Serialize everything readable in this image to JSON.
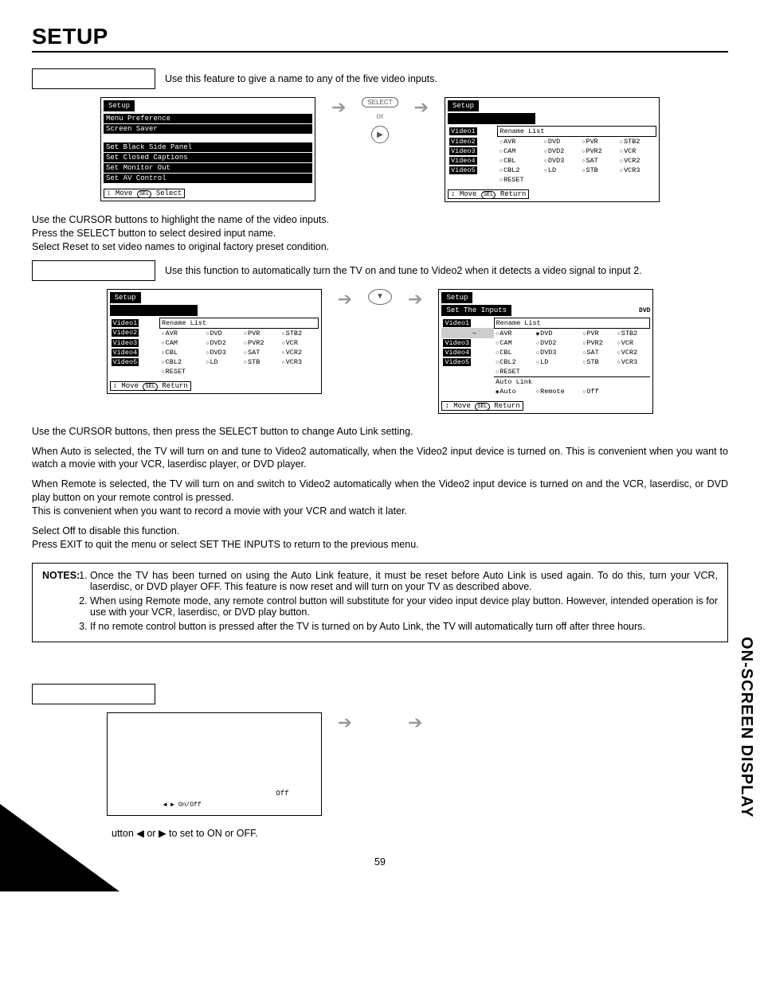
{
  "page": {
    "title": "SETUP",
    "sidebar": "ON-SCREEN DISPLAY",
    "number": "59"
  },
  "feat1": {
    "desc": "Use this feature to give a name to any of the five video inputs."
  },
  "osdA": {
    "tab": "Setup",
    "items": [
      "Menu Preference",
      "Screen Saver",
      "",
      "Set Black Side Panel",
      "Set Closed Captions",
      "Set Monitor Out",
      "Set AV Control"
    ],
    "foot_move": "Move",
    "foot_sel": "SEL",
    "foot_action": "Select"
  },
  "middle1": {
    "btn": "SELECT",
    "or": "or"
  },
  "osdB": {
    "tab": "Setup",
    "header": "Rename List",
    "videos": [
      "Video1",
      "Video2",
      "Video3",
      "Video4",
      "Video5"
    ],
    "opts": [
      [
        "AVR",
        "DVD",
        "PVR",
        "STB2"
      ],
      [
        "CAM",
        "DVD2",
        "PVR2",
        "VCR"
      ],
      [
        "CBL",
        "DVD3",
        "SAT",
        "VCR2"
      ],
      [
        "CBL2",
        "LD",
        "STB",
        "VCR3"
      ],
      [
        "RESET",
        "",
        "",
        ""
      ]
    ],
    "foot_move": "Move",
    "foot_sel": "SEL",
    "foot_action": "Return"
  },
  "para1a": "Use the CURSOR buttons to highlight the name of the video inputs.",
  "para1b": "Press the SELECT button to select desired input name.",
  "para1c": "Select Reset to set video names to original factory preset condition.",
  "feat2": {
    "desc": "Use this function to automatically turn the TV on and tune to Video2 when it detects a video signal to input 2."
  },
  "osdC": {
    "tab": "Setup",
    "header": "Rename List",
    "videos": [
      "Video1",
      "Video2",
      "Video3",
      "Video4",
      "Video5"
    ],
    "opts": [
      [
        "AVR",
        "DVD",
        "PVR",
        "STB2"
      ],
      [
        "CAM",
        "DVD2",
        "PVR2",
        "VCR"
      ],
      [
        "CBL",
        "DVD3",
        "SAT",
        "VCR2"
      ],
      [
        "CBL2",
        "LD",
        "STB",
        "VCR3"
      ],
      [
        "RESET",
        "",
        "",
        ""
      ]
    ],
    "foot_move": "Move",
    "foot_sel": "SEL",
    "foot_action": "Return"
  },
  "osdD": {
    "tab": "Setup",
    "subtitle": "Set The Inputs",
    "badge": "DVD",
    "header": "Rename List",
    "videos": [
      "Video1",
      "",
      "Video3",
      "Video4",
      "Video5"
    ],
    "opts": [
      [
        "AVR",
        "DVD",
        "PVR",
        "STB2"
      ],
      [
        "CAM",
        "DVD2",
        "PVR2",
        "VCR"
      ],
      [
        "CBL",
        "DVD3",
        "SAT",
        "VCR2"
      ],
      [
        "CBL2",
        "LD",
        "STB",
        "VCR3"
      ],
      [
        "RESET",
        "",
        "",
        ""
      ]
    ],
    "autolink_label": "Auto Link",
    "autolink_opts": [
      "Auto",
      "Remote",
      "Off"
    ],
    "foot_move": "Move",
    "foot_sel": "SEL",
    "foot_action": "Return"
  },
  "para2": "Use the CURSOR buttons, then press the SELECT button to change Auto Link setting.",
  "para3": "When Auto is selected, the TV will turn on and tune to Video2 automatically, when the Video2 input device is turned on. This is convenient when you want to watch a movie with your VCR, laserdisc player, or DVD player.",
  "para4a": "When Remote is selected, the TV will turn on and switch to Video2 automatically when the Video2 input device is turned on and the VCR, laserdisc, or DVD play button on your remote control is pressed.",
  "para4b": "This is convenient when you want to record a movie with your VCR and watch it later.",
  "para5a": "Select Off to disable this function.",
  "para5b": "Press EXIT to quit the menu or select SET THE INPUTS to return to the previous menu.",
  "notes": {
    "label": "NOTES:",
    "items": [
      "Once the TV has been turned on using the Auto Link feature, it must be reset before Auto Link is used again. To do this, turn your VCR, laserdisc, or DVD player OFF. This feature is now reset and will turn on your TV as described above.",
      "When using Remote mode, any remote control button will substitute for your video input device play button. However, intended operation is for use with your VCR, laserdisc, or DVD play button.",
      "If no remote control button is pressed after the TV is turned on by Auto Link, the TV will automatically turn off after three hours."
    ]
  },
  "osdE": {
    "val": "Off",
    "onoff": "On/Off"
  },
  "para6": "utton ◀ or ▶ to set to ON or OFF."
}
